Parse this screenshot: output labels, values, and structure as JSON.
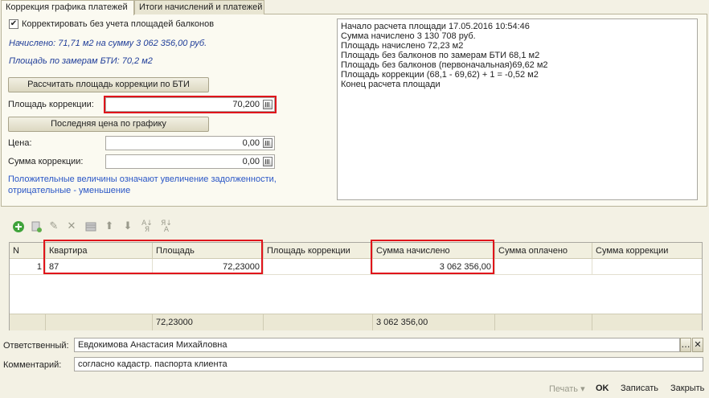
{
  "tabs": [
    {
      "label": "Коррекция графика платежей"
    },
    {
      "label": "Итоги начислений и платежей"
    }
  ],
  "options": {
    "no_balcony_checked": true,
    "no_balcony_label": "Корректировать без учета площадей балконов"
  },
  "info": {
    "accrued_text": "Начислено: 71,71 м2 на сумму 3 062 356,00 руб.",
    "bti_area_text": "Площадь по замерам БТИ: 70,2 м2"
  },
  "buttons": {
    "calc_bti": "Рассчитать площадь коррекции по БТИ",
    "last_price": "Последняя цена по графику"
  },
  "fields": {
    "correction_area_label": "Площадь коррекции:",
    "correction_area_value": "70,200",
    "price_label": "Цена:",
    "price_value": "0,00",
    "correction_sum_label": "Сумма коррекции:",
    "correction_sum_value": "0,00"
  },
  "hint_lines": [
    "Положительные величины означают увеличение задолженности,",
    "отрицательные - уменьшение"
  ],
  "log_lines": [
    "Начало расчета площади 17.05.2016 10:54:46",
    "Сумма начислено 3 130 708 руб.",
    "Площадь начислено 72,23 м2",
    "Площадь без балконов по замерам БТИ 68,1 м2",
    "Площадь без балконов (первоначальная)69,62 м2",
    "Площадь коррекции (68,1 - 69,62) + 1 = -0,52 м2",
    "Конец расчета площади"
  ],
  "toolbar_icons": [
    "add-icon",
    "copy-icon",
    "edit-icon",
    "delete-icon",
    "grid-icon",
    "move-up-icon",
    "move-down-icon",
    "sort-asc-icon",
    "sort-desc-icon"
  ],
  "table": {
    "columns": [
      "N",
      "Квартира",
      "Площадь",
      "Площадь коррекции",
      "Сумма начислено",
      "Сумма оплачено",
      "Сумма коррекции"
    ],
    "rows": [
      {
        "n": "1",
        "apartment": "87",
        "area": "72,23000",
        "correction_area": "",
        "accrued": "3 062 356,00",
        "paid": "",
        "correction_sum": ""
      }
    ],
    "totals": {
      "area": "72,23000",
      "accrued": "3 062 356,00"
    }
  },
  "footer": {
    "responsible_label": "Ответственный:",
    "responsible_value": "Евдокимова Анастасия Михайловна",
    "comment_label": "Комментарий:",
    "comment_value": "согласно кадастр. паспорта клиента"
  },
  "bottom_buttons": {
    "print": "Печать",
    "ok": "OK",
    "save": "Записать",
    "close": "Закрыть"
  },
  "colors": {
    "highlight": "#e0141b",
    "hint": "#2a56c6",
    "info": "#1f3d99"
  }
}
